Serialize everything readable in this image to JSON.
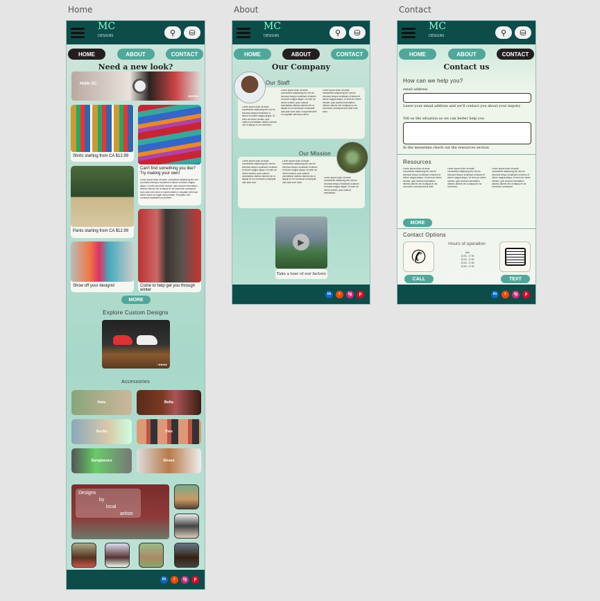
{
  "colors": {
    "dark_teal": "#0c4d4a",
    "accent": "#4fa89a",
    "active": "#231f20",
    "page_bg": "#e5e5e5"
  },
  "frames": {
    "home": "Home",
    "about": "About",
    "contact": "Contact"
  },
  "header": {
    "logo": "MC",
    "logo_sub": "DESIGNS",
    "search_icon": "search-icon",
    "basket_icon": "basket-icon"
  },
  "nav": {
    "home": "HOME",
    "about": "ABOUT",
    "contact": "CONTACT"
  },
  "home": {
    "headline": "Need a new look?",
    "hero_text": "Hello SC",
    "tiles": {
      "shirts": "Shirts starting from CA $12.99",
      "pants": "Pants starting from CA $12.99",
      "show_off": "Show off your designs!",
      "cant_find": "Can't find something you like? Try making your own!",
      "come_help": "Come to help get you through winter"
    },
    "more": "MORE",
    "custom_title": "Explore Custom Designs",
    "accessories_title": "Accessories",
    "accessories": [
      "Hats",
      "Belts",
      "Socks",
      "Ties",
      "Sunglasses",
      "Shoes"
    ],
    "artists_banner": [
      "Designs",
      "by",
      "local",
      "artists"
    ]
  },
  "about": {
    "title": "Our Company",
    "staff_title": "Our Staff",
    "mission_title": "Our Mission",
    "tour_caption": "Take a tour of our factory"
  },
  "contact": {
    "title": "Contact us",
    "help_title": "How can we help you?",
    "email_label": "email address",
    "email_hint": "Leave your email address and we'll contact you about your inquiry",
    "situation_label": "Tell us the situation so we can better help you",
    "resources_hint": "In the meantime check out the resources section",
    "resources_title": "Resources",
    "more": "MORE",
    "options_title": "Contact Options",
    "hours_title": "Hours of operation",
    "call": "CALL",
    "text": "TEXT"
  },
  "social": [
    "in",
    "r",
    "ig",
    "p"
  ]
}
